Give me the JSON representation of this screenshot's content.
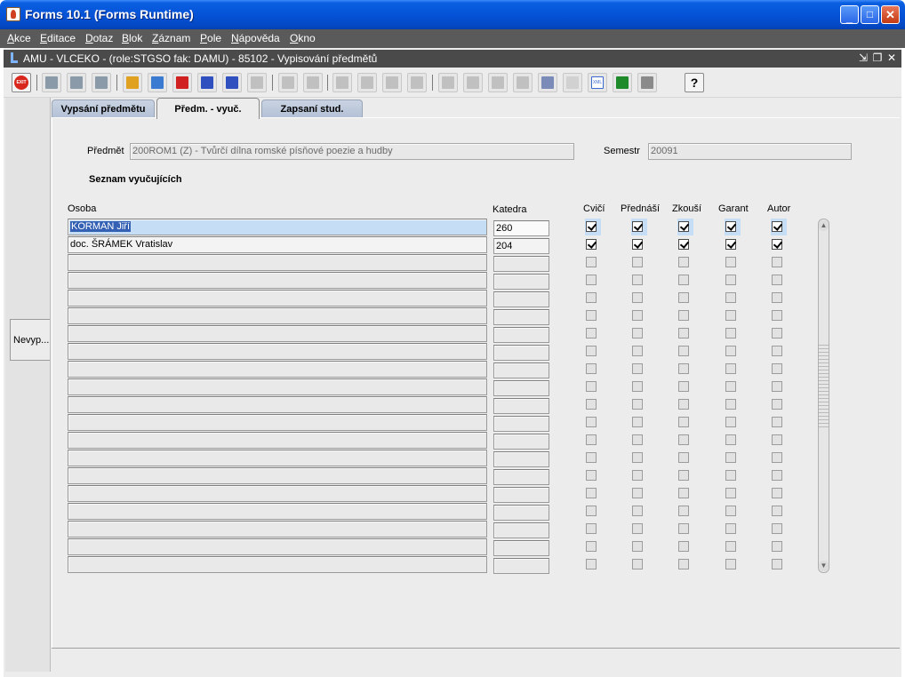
{
  "window": {
    "title": "Forms 10.1 (Forms Runtime)"
  },
  "menu": [
    {
      "u": "A",
      "rest": "kce"
    },
    {
      "u": "E",
      "rest": "ditace"
    },
    {
      "u": "D",
      "rest": "otaz"
    },
    {
      "u": "B",
      "rest": "lok"
    },
    {
      "u": "Z",
      "rest": "áznam"
    },
    {
      "u": "P",
      "rest": "ole"
    },
    {
      "u": "N",
      "rest": "ápověda"
    },
    {
      "u": "O",
      "rest": "kno"
    }
  ],
  "form": {
    "title": "AMU - VLCEKO - (role:STGSO fak: DAMU) - 85102 - Vypisování předmětů"
  },
  "toolbar": {
    "icons": [
      "exit-icon",
      "save-icon",
      "print-icon",
      "clear-icon",
      "enter-query-icon",
      "execute-query-icon",
      "count-query-icon",
      "sort-asc-icon",
      "sort-desc-icon",
      "sort-multi-icon",
      "copy-icon",
      "paste-icon",
      "cut-icon",
      "insert-record-icon",
      "delete-record-icon",
      "duplicate-icon",
      "list-icon",
      "lock-icon",
      "edit-icon",
      "refresh-icon",
      "chart-icon",
      "clock-icon",
      "xml-export-icon",
      "excel-export-icon",
      "layout-icon",
      "help-icon"
    ],
    "exit_label": "EXIT",
    "help_label": "?",
    "xml_label": "XML"
  },
  "side": {
    "button": "Nevyp..."
  },
  "tabs": [
    {
      "label": "Vypsání předmětu",
      "active": false
    },
    {
      "label": "Předm. - vyuč.",
      "active": true
    },
    {
      "label": "Zapsaní stud.",
      "active": false
    }
  ],
  "header": {
    "subject_label": "Předmět",
    "subject_value": "200ROM1 (Z) - Tvůrčí dílna romské písňové poezie a hudby",
    "semester_label": "Semestr",
    "semester_value": "20091",
    "section_title": "Seznam vyučujících"
  },
  "columns": {
    "person": "Osoba",
    "department": "Katedra",
    "checks": [
      "Cvičí",
      "Přednáší",
      "Zkouší",
      "Garant",
      "Autor"
    ]
  },
  "rows": [
    {
      "person": "KORMAN Jiří",
      "department": "260",
      "checks": [
        true,
        true,
        true,
        true,
        true
      ]
    },
    {
      "person": "doc. ŠRÁMEK Vratislav",
      "department": "204",
      "checks": [
        true,
        true,
        true,
        true,
        true
      ]
    }
  ],
  "total_rows": 20,
  "colors": {
    "selected_row": "#c6ddf6",
    "selection": "#3561b5",
    "titlebar": "#0553d8"
  }
}
